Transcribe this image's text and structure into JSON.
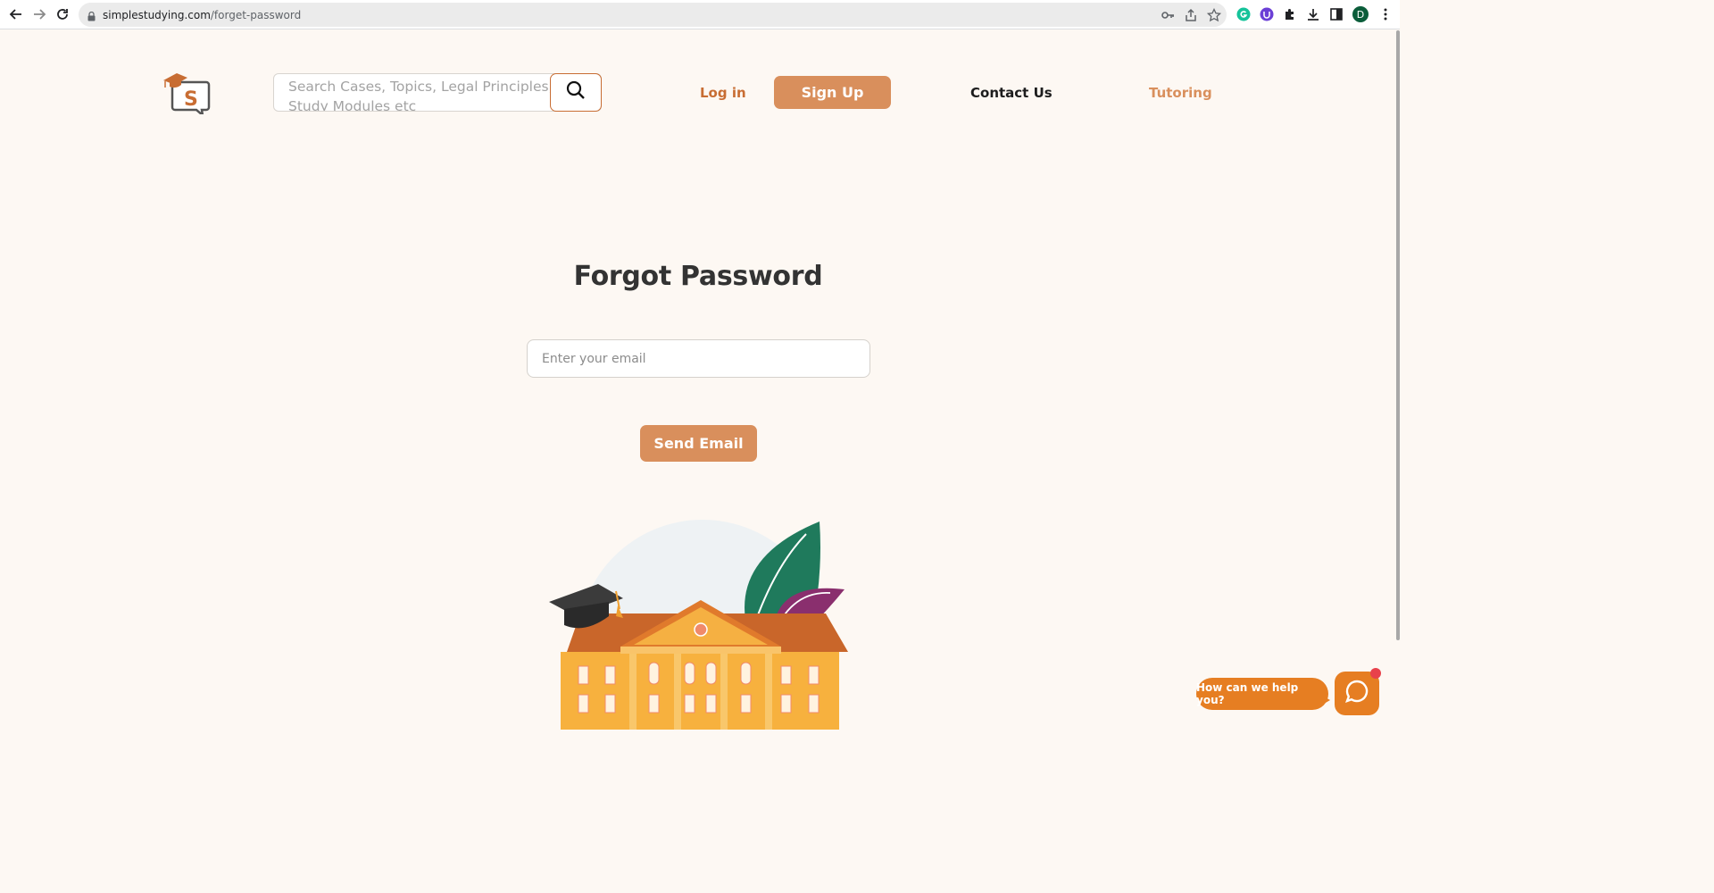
{
  "browser": {
    "url_domain": "simplestudying.com",
    "url_path": "/forget-password",
    "profile_initial": "D"
  },
  "header": {
    "search_placeholder": "Search Cases, Topics, Legal Principles, Study Modules etc",
    "login_label": "Log in",
    "signup_label": "Sign Up",
    "contact_label": "Contact Us",
    "tutoring_label": "Tutoring"
  },
  "main": {
    "title": "Forgot Password",
    "email_placeholder": "Enter your email",
    "send_label": "Send Email"
  },
  "chat": {
    "bubble_text": "How can we help you?"
  },
  "colors": {
    "brand_orange": "#c86d33",
    "button_orange": "#d98f5c",
    "chat_orange": "#e67e22",
    "background": "#fdf8f3"
  }
}
